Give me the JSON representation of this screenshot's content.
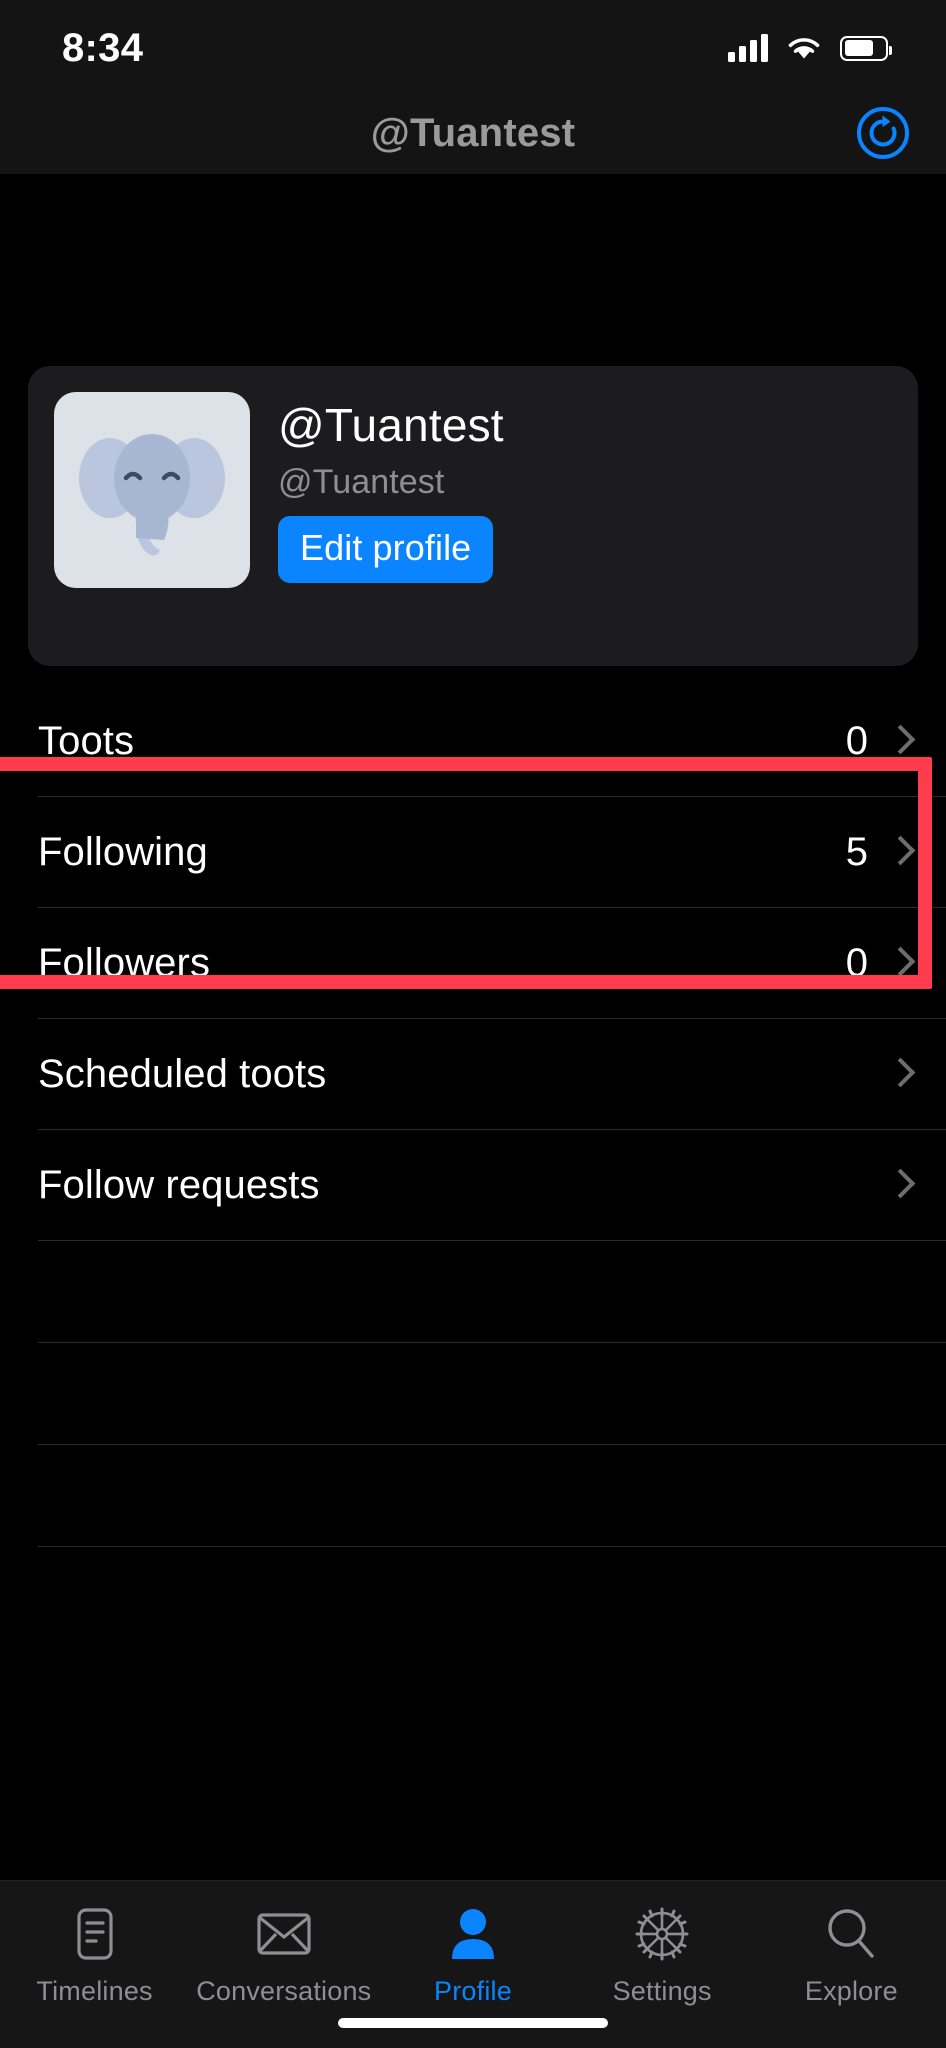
{
  "status_bar": {
    "time": "8:34",
    "cellular_icon": "cellular-signal-icon",
    "wifi_icon": "wifi-icon",
    "battery_icon": "battery-icon"
  },
  "nav": {
    "title": "@Tuantest",
    "refresh_icon": "refresh-icon",
    "accent": "#0a84ff"
  },
  "profile": {
    "avatar_icon": "elephant-avatar",
    "display_name": "@Tuantest",
    "handle": "@Tuantest",
    "edit_button": "Edit profile",
    "edit_button_color": "#0a84ff",
    "card_bg": "#1c1c1e"
  },
  "list": {
    "rows": [
      {
        "label": "Toots",
        "value": "0",
        "chevron": true,
        "highlighted": false
      },
      {
        "label": "Following",
        "value": "5",
        "chevron": true,
        "highlighted": true
      },
      {
        "label": "Followers",
        "value": "0",
        "chevron": true,
        "highlighted": true
      },
      {
        "label": "Scheduled toots",
        "value": "",
        "chevron": true,
        "highlighted": false
      },
      {
        "label": "Follow requests",
        "value": "",
        "chevron": true,
        "highlighted": false
      },
      {
        "label": "",
        "value": "",
        "chevron": false,
        "highlighted": false
      },
      {
        "label": "",
        "value": "",
        "chevron": false,
        "highlighted": false
      },
      {
        "label": "",
        "value": "",
        "chevron": false,
        "highlighted": false
      }
    ],
    "highlight_color": "#ff3b4e"
  },
  "tabbar": {
    "active_index": 2,
    "active_color": "#0a84ff",
    "inactive_color": "#8e8e93",
    "tabs": [
      {
        "label": "Timelines",
        "icon": "timelines-icon"
      },
      {
        "label": "Conversations",
        "icon": "envelope-icon"
      },
      {
        "label": "Profile",
        "icon": "person-icon"
      },
      {
        "label": "Settings",
        "icon": "gear-icon"
      },
      {
        "label": "Explore",
        "icon": "search-icon"
      }
    ]
  }
}
